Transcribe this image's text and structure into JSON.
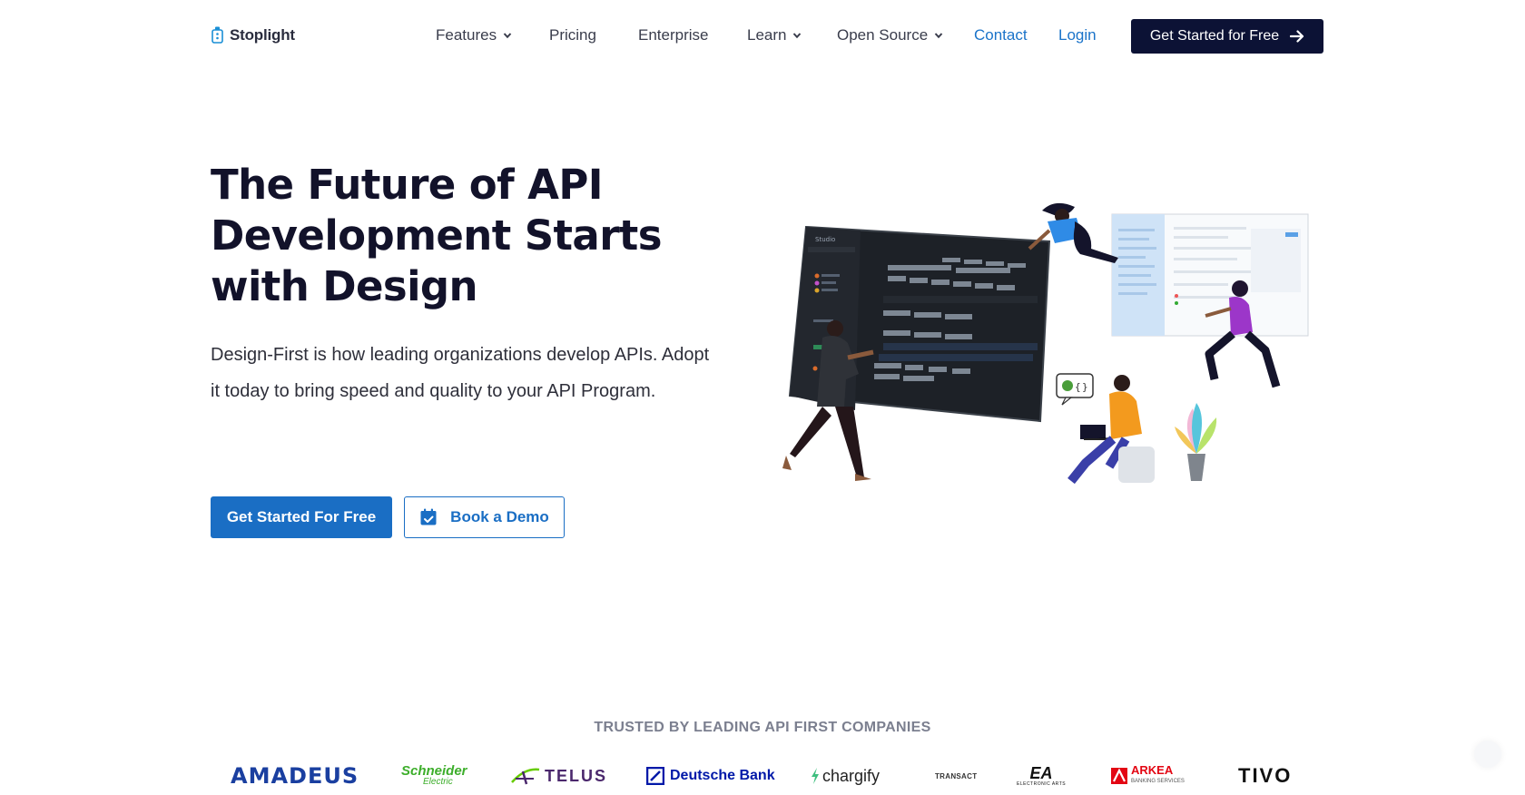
{
  "nav": {
    "logo_text": "Stoplight",
    "items": [
      {
        "label": "Features",
        "has_dropdown": true
      },
      {
        "label": "Pricing",
        "has_dropdown": false
      },
      {
        "label": "Enterprise",
        "has_dropdown": false
      },
      {
        "label": "Learn",
        "has_dropdown": true
      },
      {
        "label": "Open Source",
        "has_dropdown": true
      },
      {
        "label": "Contact",
        "has_dropdown": false
      },
      {
        "label": "Login",
        "has_dropdown": false
      }
    ],
    "cta_label": "Get Started for Free",
    "cta_icon": "arrow-right-icon"
  },
  "hero": {
    "title": "The Future of API Development Starts with Design",
    "subtitle": "Design-First is how leading organizations develop APIs. Adopt it today to bring speed and quality to your API Program.",
    "primary_button": "Get Started For Free",
    "secondary_button": "Book a Demo",
    "secondary_icon": "calendar-icon"
  },
  "illustration": {
    "studio_title": "Studio"
  },
  "trusted": {
    "heading": "TRUSTED BY LEADING API FIRST COMPANIES",
    "logos": [
      {
        "name": "AMADEUS",
        "color": "#1a3fa0"
      },
      {
        "name": "Schneider",
        "sub": "Electric",
        "color": "#3dae2b"
      },
      {
        "name": "TELUS",
        "color": "#4b286d"
      },
      {
        "name": "Deutsche Bank",
        "color": "#0018a8"
      },
      {
        "name": "chargify",
        "color": "#222222"
      },
      {
        "name": "TRANSACT",
        "color": "#333333"
      },
      {
        "name": "EA",
        "sub": "ELECTRONIC ARTS",
        "color": "#111111"
      },
      {
        "name": "ARKEA",
        "sub": "BANKING SERVICES",
        "color": "#e30613"
      },
      {
        "name": "TIVO",
        "color": "#111111"
      }
    ]
  },
  "colors": {
    "brand_dark": "#0c1235",
    "brand_blue": "#1a6ec4",
    "link_blue": "#1a73c9",
    "heading": "#12122a"
  }
}
